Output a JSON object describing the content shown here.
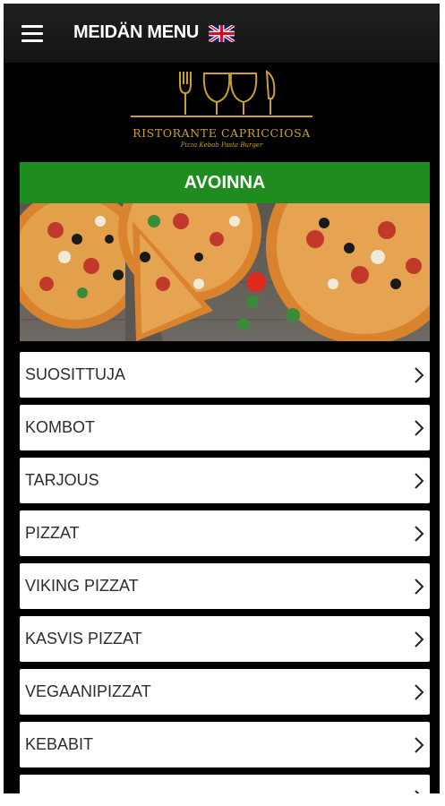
{
  "header": {
    "title": "MEIDÄN MENU",
    "language_flag": "uk-flag-icon"
  },
  "logo": {
    "name": "RISTORANTE CAPRICCIOSA",
    "tagline": "Pizza Kebab Pasta Burger",
    "color": "#c9a227"
  },
  "status": {
    "text": "AVOINNA",
    "color": "#1e8c1e"
  },
  "menu": {
    "items": [
      {
        "label": "SUOSITTUJA"
      },
      {
        "label": "KOMBOT"
      },
      {
        "label": "TARJOUS"
      },
      {
        "label": "PIZZAT"
      },
      {
        "label": "VIKING PIZZAT"
      },
      {
        "label": "KASVIS PIZZAT"
      },
      {
        "label": "VEGAANIPIZZAT"
      },
      {
        "label": "KEBABIT"
      },
      {
        "label": ""
      }
    ]
  }
}
